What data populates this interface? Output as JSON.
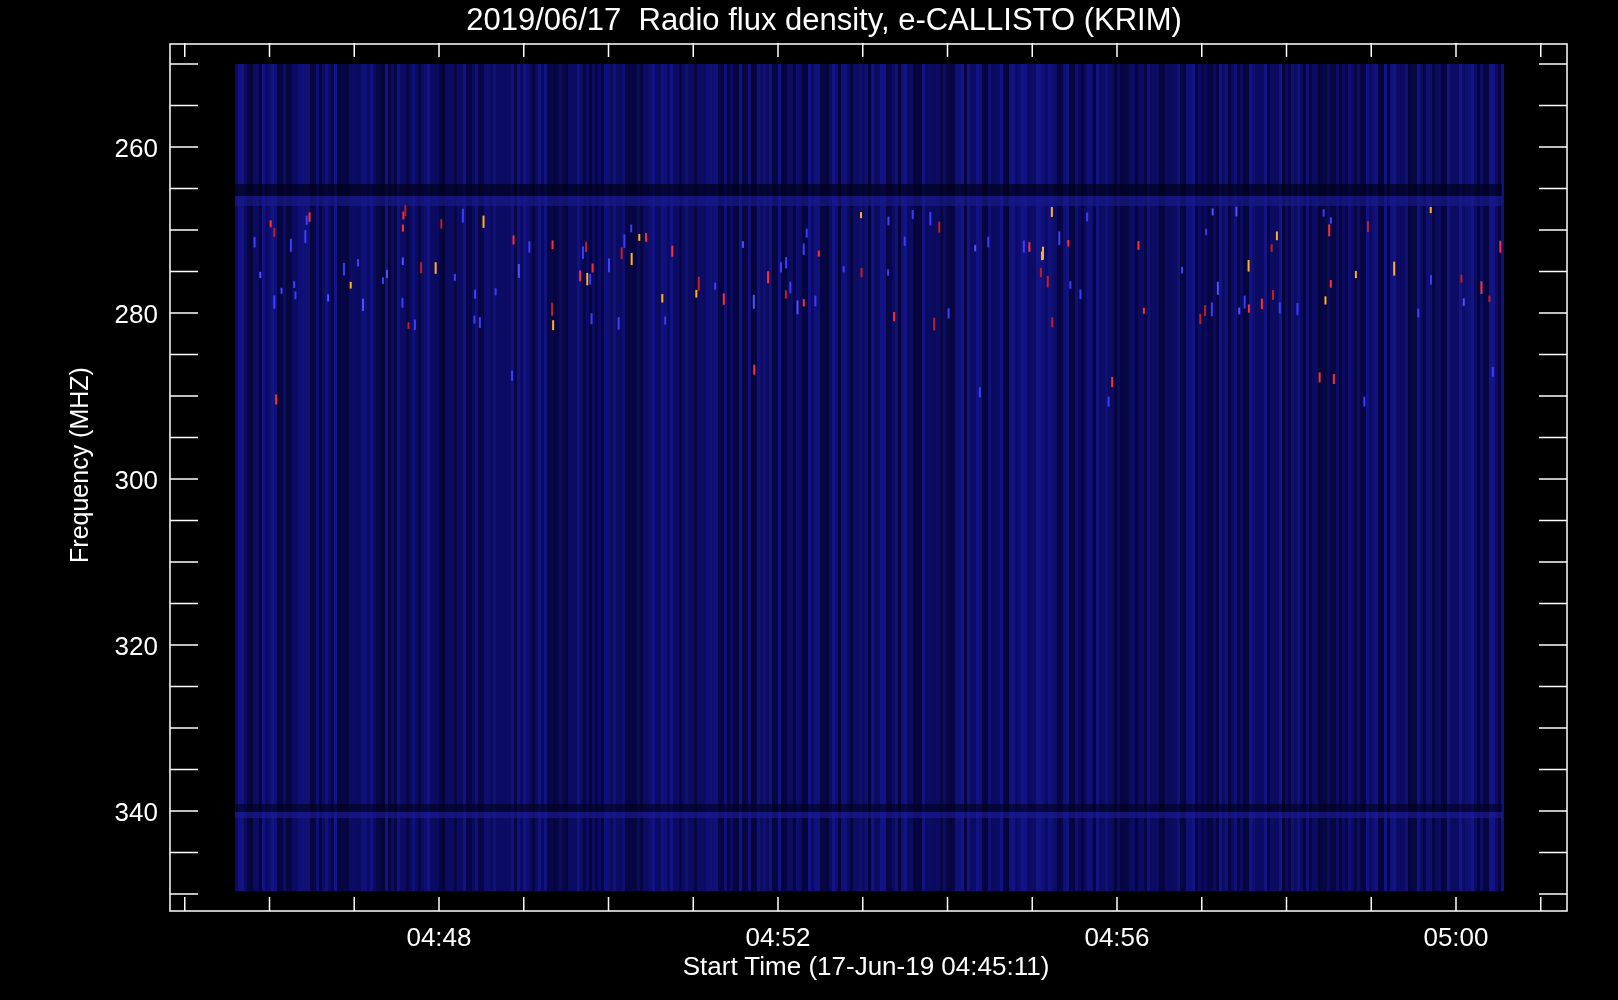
{
  "title": "2019/06/17  Radio flux density, e-CALLISTO (KRIM)",
  "y_axis": {
    "label": "Frequency (MHZ)",
    "ticks": [
      "260",
      "280",
      "300",
      "320",
      "340"
    ]
  },
  "x_axis": {
    "label": "Start Time (17-Jun-19 04:45:11)",
    "ticks": [
      "04:48",
      "04:52",
      "04:56",
      "05:00"
    ]
  }
}
